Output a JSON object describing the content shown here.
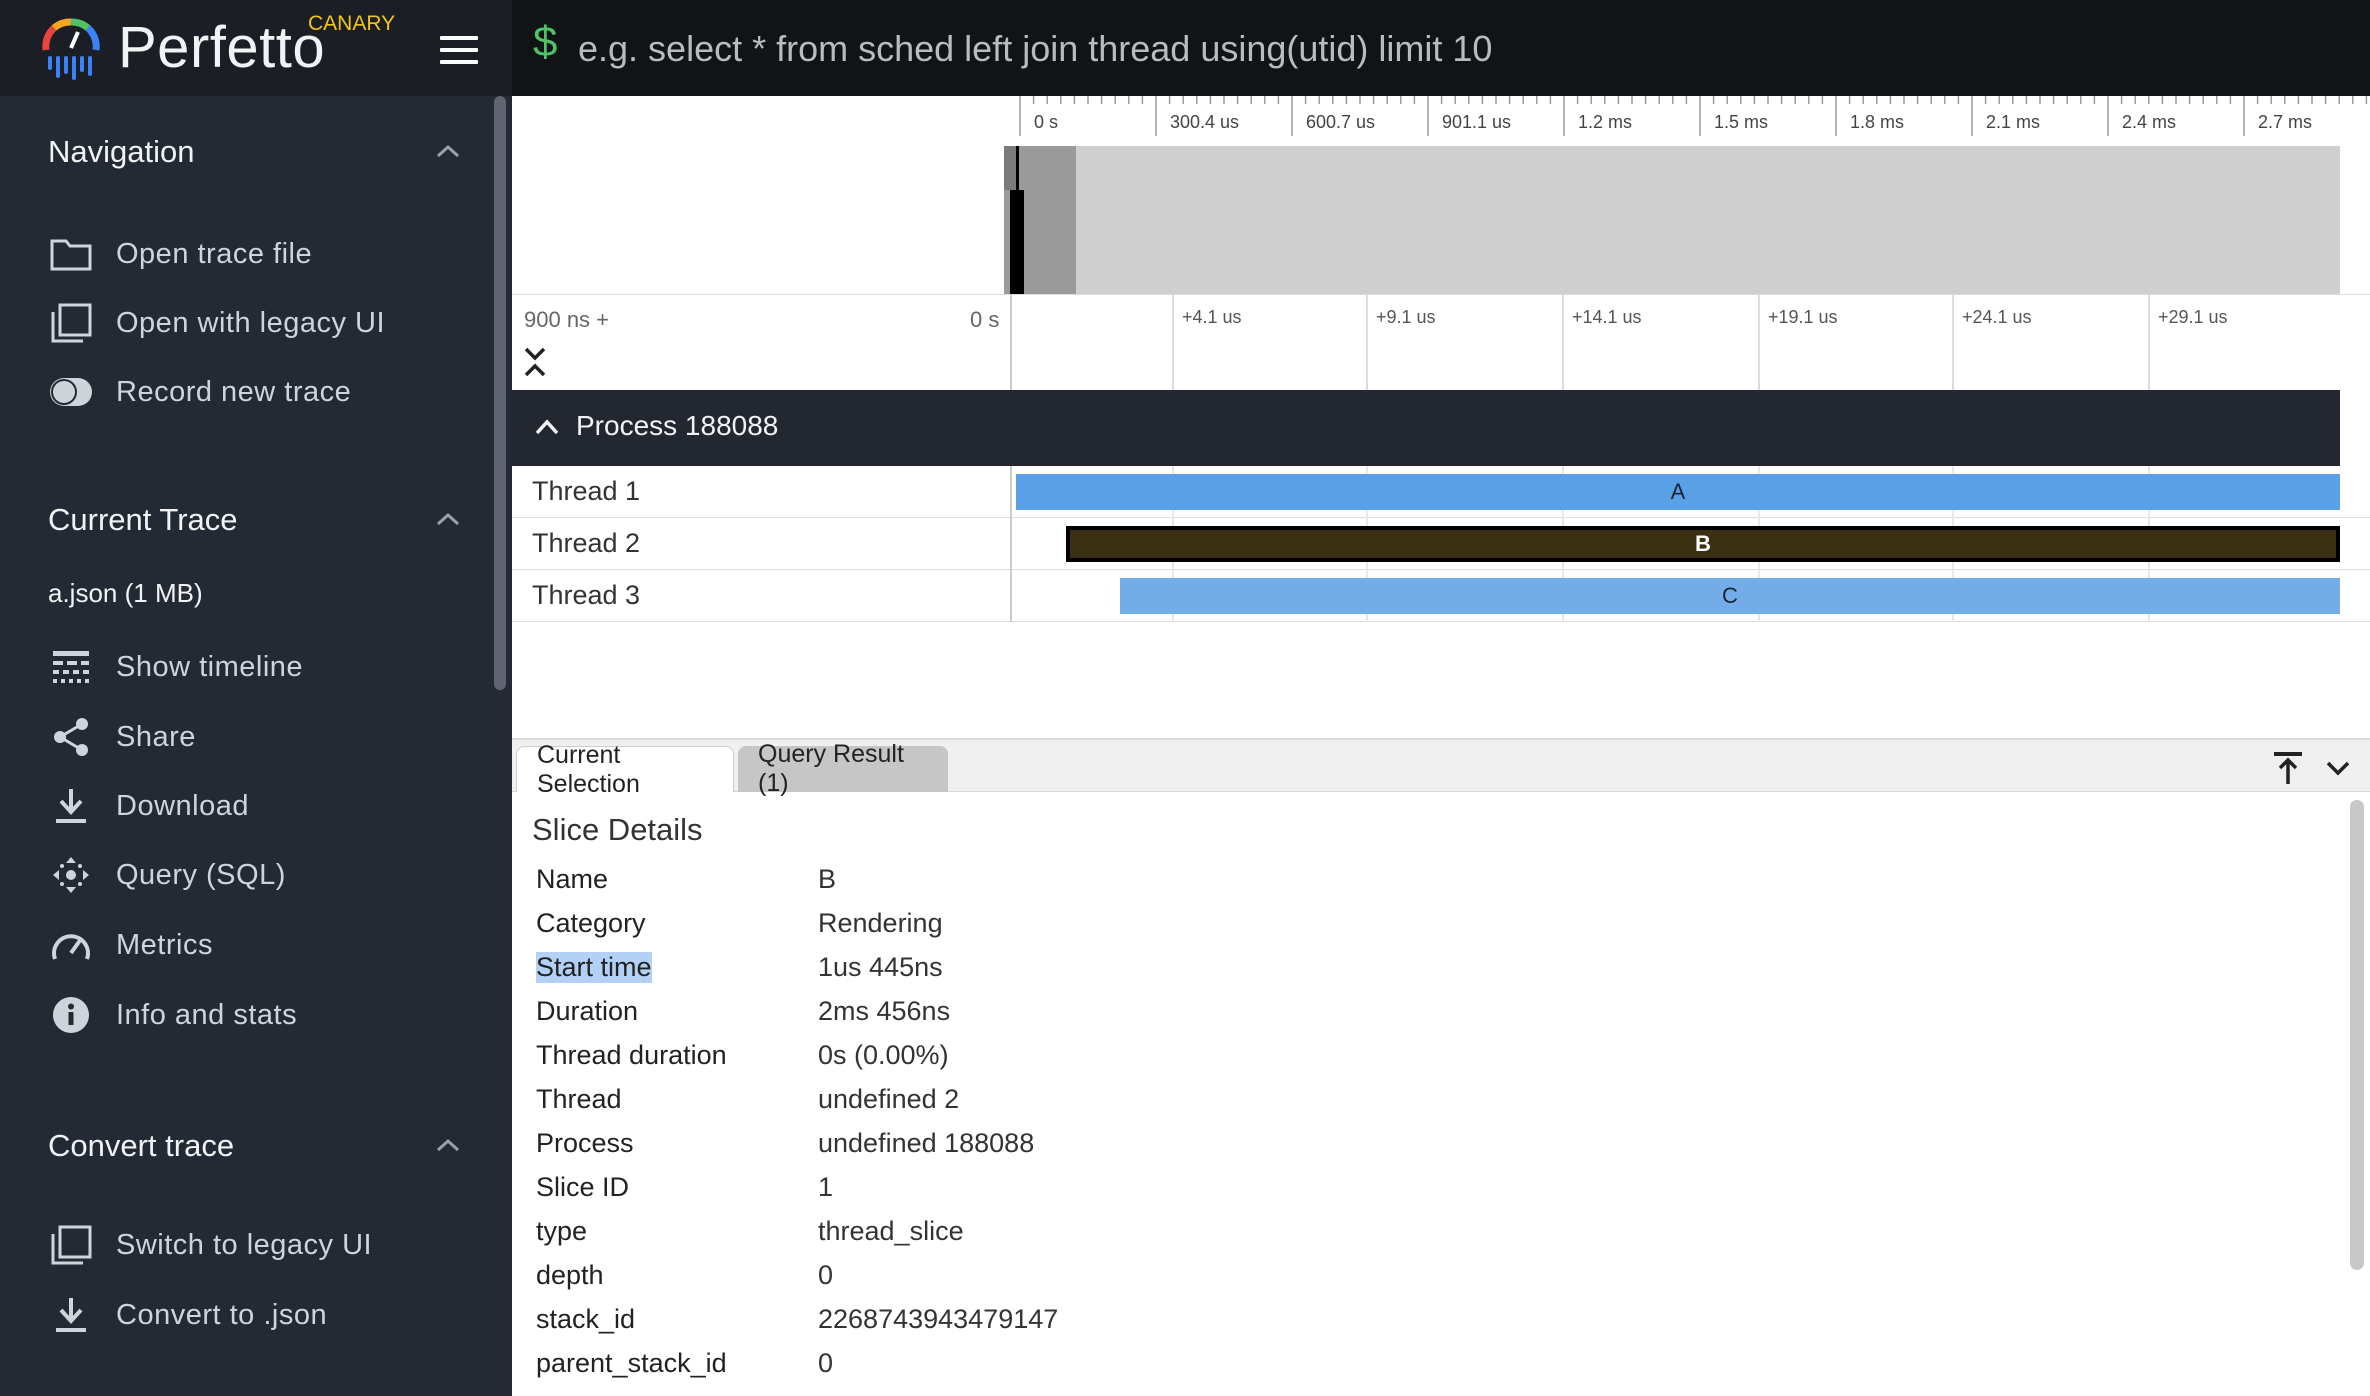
{
  "app": {
    "brand": "Perfetto",
    "channel": "CANARY"
  },
  "colors": {
    "accent_green": "#4fc167",
    "canary": "#f0c419",
    "slice_a": "#5aa0e6",
    "slice_b": "#3b2f14",
    "slice_c": "#72adea"
  },
  "omnibox": {
    "prompt": "$",
    "placeholder": "e.g. select * from sched left join thread using(utid) limit 10",
    "value": ""
  },
  "sidebar": {
    "sections": [
      {
        "title": "Navigation",
        "items": [
          {
            "label": "Open trace file",
            "icon": "folder-icon"
          },
          {
            "label": "Open with legacy UI",
            "icon": "legacy-window-icon"
          },
          {
            "label": "Record new trace",
            "icon": "record-toggle-icon"
          }
        ]
      },
      {
        "title": "Current Trace",
        "trace_name": "a.json (1 MB)",
        "items": [
          {
            "label": "Show timeline",
            "icon": "timeline-icon"
          },
          {
            "label": "Share",
            "icon": "share-icon"
          },
          {
            "label": "Download",
            "icon": "download-icon"
          },
          {
            "label": "Query (SQL)",
            "icon": "query-icon"
          },
          {
            "label": "Metrics",
            "icon": "speedometer-icon"
          },
          {
            "label": "Info and stats",
            "icon": "info-icon"
          }
        ]
      },
      {
        "title": "Convert trace",
        "items": [
          {
            "label": "Switch to legacy UI",
            "icon": "legacy-window-icon"
          },
          {
            "label": "Convert to .json",
            "icon": "download-icon"
          }
        ]
      }
    ]
  },
  "timeline": {
    "overview_ticks": [
      "0 s",
      "300.4 us",
      "600.7 us",
      "901.1 us",
      "1.2 ms",
      "1.5 ms",
      "1.8 ms",
      "2.1 ms",
      "2.4 ms",
      "2.7 ms"
    ],
    "offset_label": "900 ns +",
    "zero_label": "0 s",
    "detail_ticks": [
      "+4.1 us",
      "+9.1 us",
      "+14.1 us",
      "+19.1 us",
      "+24.1 us",
      "+29.1 us"
    ],
    "process": {
      "title": "Process 188088"
    },
    "threads": [
      {
        "name": "Thread 1",
        "slice": "A"
      },
      {
        "name": "Thread 2",
        "slice": "B"
      },
      {
        "name": "Thread 3",
        "slice": "C"
      }
    ]
  },
  "details": {
    "tabs": [
      {
        "label": "Current Selection",
        "active": true
      },
      {
        "label": "Query Result (1)",
        "active": false
      }
    ],
    "title": "Slice Details",
    "rows": [
      {
        "key": "Name",
        "value": "B"
      },
      {
        "key": "Category",
        "value": "Rendering"
      },
      {
        "key": "Start time",
        "value": "1us 445ns"
      },
      {
        "key": "Duration",
        "value": "2ms 456ns"
      },
      {
        "key": "Thread duration",
        "value": "0s (0.00%)"
      },
      {
        "key": "Thread",
        "value": "undefined 2"
      },
      {
        "key": "Process",
        "value": "undefined 188088"
      },
      {
        "key": "Slice ID",
        "value": "1"
      },
      {
        "key": "type",
        "value": "thread_slice"
      },
      {
        "key": "depth",
        "value": "0"
      },
      {
        "key": "stack_id",
        "value": "2268743943479147"
      },
      {
        "key": "parent_stack_id",
        "value": "0"
      }
    ]
  }
}
